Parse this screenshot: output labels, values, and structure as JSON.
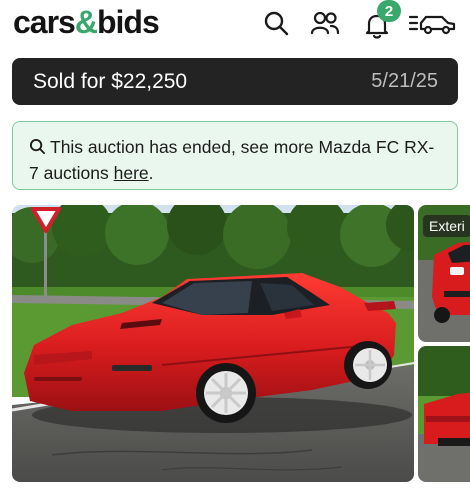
{
  "header": {
    "logo_left": "cars",
    "logo_amp": "&",
    "logo_right": "bids",
    "icons": [
      "search-icon",
      "users-icon",
      "bell-icon",
      "garage-menu-icon"
    ],
    "notification_count": "2"
  },
  "sold_bar": {
    "label": "Sold for $22,250",
    "date": "5/21/25"
  },
  "notice": {
    "text_before_link": "This auction has ended, see more Mazda FC RX-7 auctions ",
    "link_text": "here",
    "text_after_link": "."
  },
  "gallery": {
    "thumb_label": "Exteri"
  },
  "colors": {
    "brand_green": "#3aa76d",
    "sold_bar_bg": "#232323",
    "notice_bg": "#eaf7ef",
    "notice_border": "#7fcb9f",
    "car_red": "#d81c1e"
  }
}
